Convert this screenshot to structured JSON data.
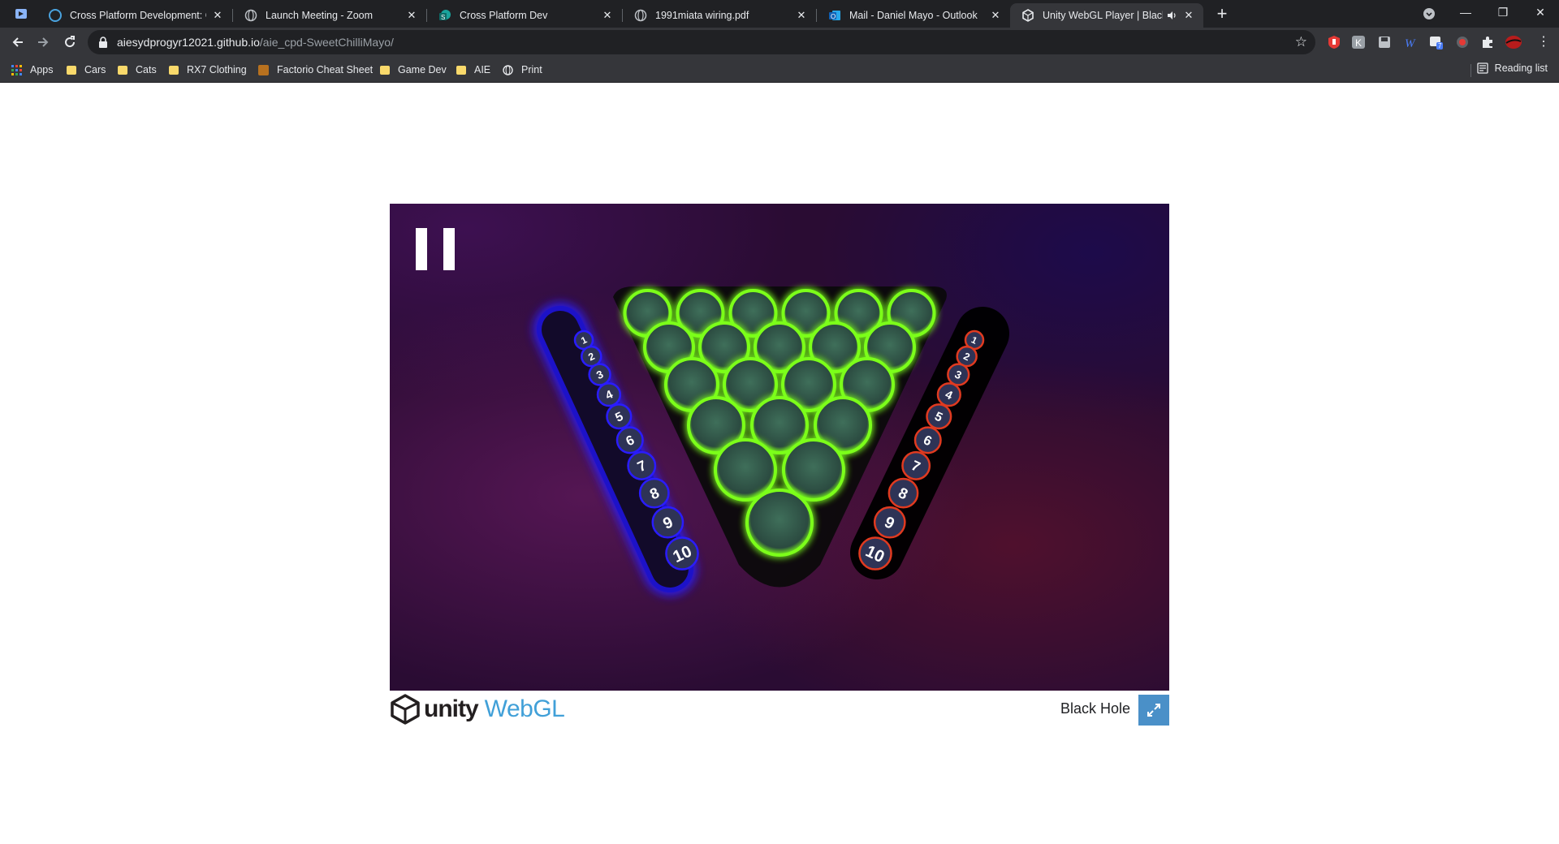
{
  "browser": {
    "tabs": [
      {
        "title": "Cross Platform Development: Ga",
        "icon": "cross-platform-dev-icon"
      },
      {
        "title": "Launch Meeting - Zoom",
        "icon": "globe-icon"
      },
      {
        "title": "Cross Platform Dev",
        "icon": "sharepoint-icon"
      },
      {
        "title": "1991miata wiring.pdf",
        "icon": "globe-icon"
      },
      {
        "title": "Mail - Daniel Mayo - Outlook",
        "icon": "outlook-icon"
      },
      {
        "title": "Unity WebGL Player | Black H",
        "icon": "unity-icon",
        "active": true,
        "audio": true
      }
    ],
    "url_host": "aiesydprogyr12021.github.io",
    "url_path": "/aie_cpd-SweetChilliMayo/",
    "bookmarks": [
      {
        "label": "Apps",
        "icon": "apps-grid-icon"
      },
      {
        "label": "Cars",
        "icon": "folder-icon"
      },
      {
        "label": "Cats",
        "icon": "folder-icon"
      },
      {
        "label": "RX7 Clothing",
        "icon": "folder-icon"
      },
      {
        "label": "Factorio Cheat Sheet",
        "icon": "factorio-icon"
      },
      {
        "label": "Game Dev",
        "icon": "folder-icon"
      },
      {
        "label": "AIE",
        "icon": "folder-icon"
      },
      {
        "label": "Print",
        "icon": "globe-icon"
      }
    ],
    "reading_list": "Reading list",
    "extension_badge": "7"
  },
  "player": {
    "unity_word": "unity",
    "webgl_word": "WebGL",
    "title": "Black Hole"
  },
  "game": {
    "left_rack_numbers": [
      "1",
      "2",
      "3",
      "4",
      "5",
      "6",
      "7",
      "8",
      "9",
      "10"
    ],
    "right_rack_numbers": [
      "1",
      "2",
      "3",
      "4",
      "5",
      "6",
      "7",
      "8",
      "9",
      "10"
    ],
    "hole_rows": [
      6,
      5,
      4,
      3,
      2,
      1
    ],
    "colors": {
      "left": "#2a1cff",
      "right": "#e03a20",
      "holes": "#7cff1a"
    }
  }
}
